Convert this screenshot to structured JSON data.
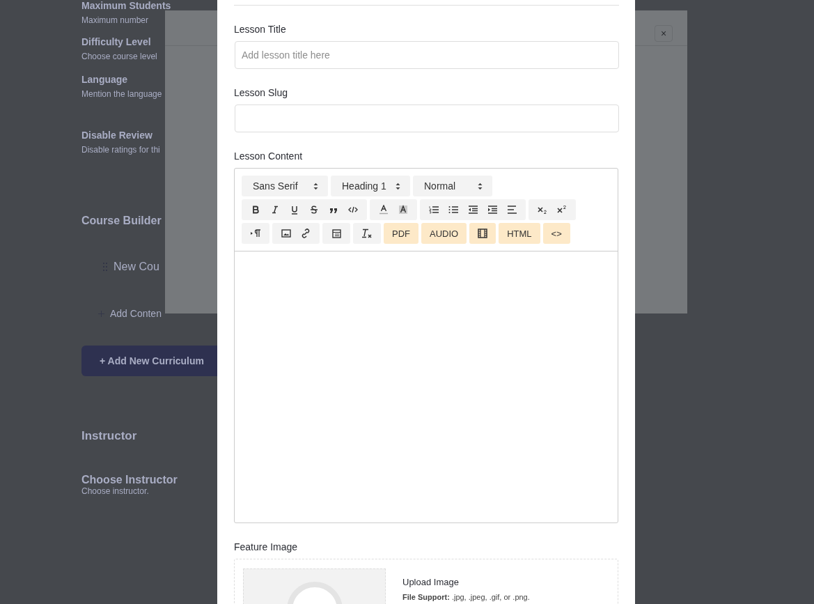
{
  "background_page": {
    "settings": [
      {
        "title": "Maximum Students",
        "description": "Maximum number"
      },
      {
        "title": "Difficulty Level",
        "description": "Choose course level"
      },
      {
        "title": "Language",
        "description": "Mention the language"
      },
      {
        "title": "Disable Review",
        "description": "Disable ratings for thi"
      }
    ],
    "course_builder": {
      "title": "Course Builder",
      "topic": "New Cou",
      "add_content": "Add Conten",
      "add_button": "+ Add New Curriculum"
    },
    "instructor": {
      "title": "Instructor",
      "field_title": "Choose Instructor",
      "field_description": "Choose instructor."
    }
  },
  "topic_modal": {
    "close": "×"
  },
  "lesson_modal": {
    "title_label": "Lesson Title",
    "title_placeholder": "Add lesson title here",
    "slug_label": "Lesson Slug",
    "content_label": "Lesson Content",
    "selects": [
      "Sans Serif",
      "Heading 1",
      "Normal"
    ],
    "media_buttons": [
      {
        "kind": "text",
        "label": "PDF"
      },
      {
        "kind": "text",
        "label": "AUDIO"
      },
      {
        "kind": "icon"
      },
      {
        "kind": "text",
        "label": "HTML"
      },
      {
        "kind": "text",
        "label": "<>"
      }
    ],
    "feature_label": "Feature Image",
    "upload_title": "Upload Image",
    "upload_note": "**File Support:** .jpg, .jpeg, .gif, or .png."
  }
}
